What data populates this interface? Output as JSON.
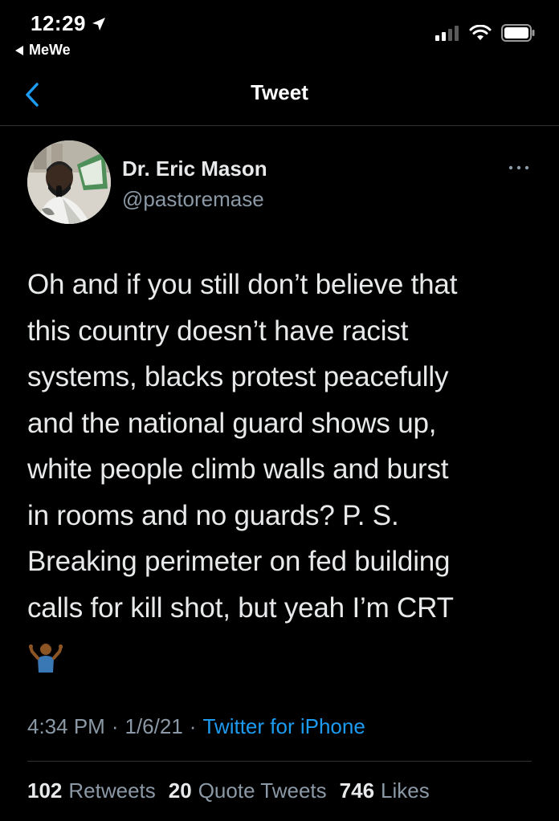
{
  "status_bar": {
    "time": "12:29",
    "back_app": "MeWe"
  },
  "nav": {
    "title": "Tweet",
    "back_icon": "chevron-left-icon"
  },
  "tweet": {
    "author_name": "Dr. Eric Mason",
    "author_handle": "@pastoremase",
    "text": "Oh and if you still don’t believe that\nthis country doesn’t have racist\nsystems, blacks protest peacefully\nand the national guard shows up,\nwhite people climb walls and burst\nin rooms and no guards? P. S.\nBreaking perimeter on fed building\ncalls for kill shot, but yeah I’m CRT",
    "emoji": "person-shrugging-emoji",
    "time": "4:34 PM",
    "separator": "·",
    "date": "1/6/21",
    "source": "Twitter for iPhone"
  },
  "stats": {
    "retweets_count": "102",
    "retweets_label": "Retweets",
    "quotes_count": "20",
    "quotes_label": "Quote Tweets",
    "likes_count": "746",
    "likes_label": "Likes"
  },
  "colors": {
    "background": "#000000",
    "text": "#e7e9ea",
    "secondary_text": "#8b98a5",
    "link": "#1d9bf0",
    "divider": "#2f3336"
  }
}
